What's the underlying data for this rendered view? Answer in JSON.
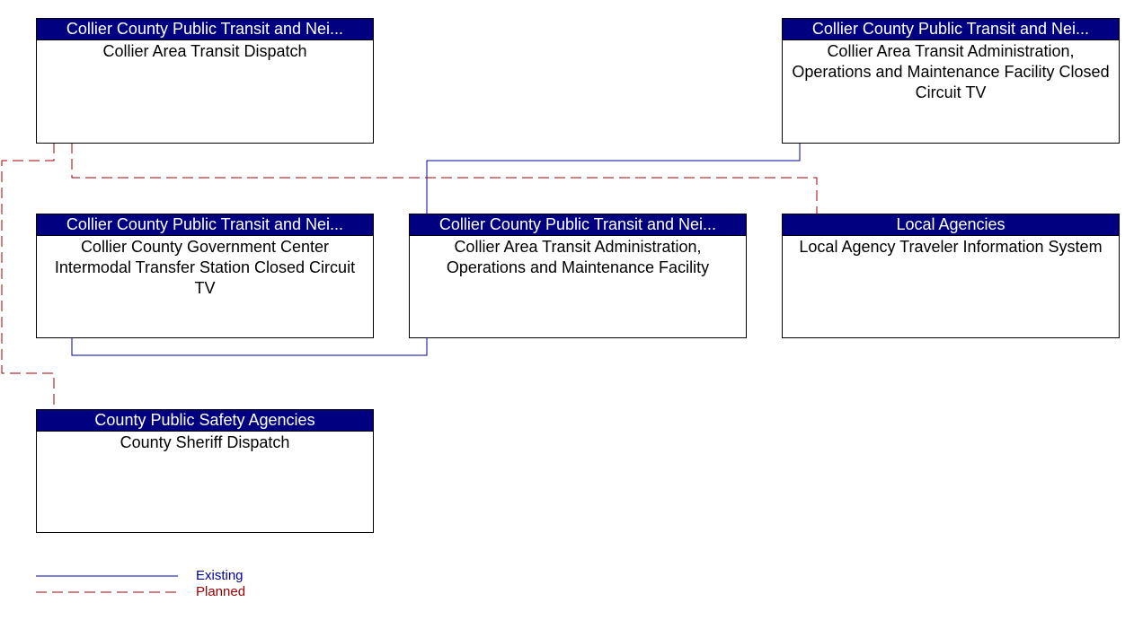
{
  "nodes": [
    {
      "id": "dispatch",
      "header": "Collier County Public Transit and Nei...",
      "body": "Collier Area Transit Dispatch"
    },
    {
      "id": "admin_cctv",
      "header": "Collier County Public Transit and Nei...",
      "body": "Collier Area Transit Administration, Operations and Maintenance Facility Closed Circuit TV"
    },
    {
      "id": "govctr_cctv",
      "header": "Collier County Public Transit and Nei...",
      "body": "Collier County Government Center Intermodal Transfer Station Closed Circuit TV"
    },
    {
      "id": "admin_facility",
      "header": "Collier County Public Transit and Nei...",
      "body": "Collier Area Transit Administration, Operations and Maintenance Facility"
    },
    {
      "id": "local_tis",
      "header": "Local Agencies",
      "body": "Local Agency Traveler Information System"
    },
    {
      "id": "sheriff",
      "header": "County Public Safety Agencies",
      "body": "County Sheriff Dispatch"
    }
  ],
  "connections": [
    {
      "from": "admin_cctv",
      "to": "admin_facility",
      "status": "existing"
    },
    {
      "from": "govctr_cctv",
      "to": "admin_facility",
      "status": "existing"
    },
    {
      "from": "dispatch",
      "to": "local_tis",
      "status": "planned"
    },
    {
      "from": "dispatch",
      "to": "sheriff",
      "status": "planned"
    }
  ],
  "legend": {
    "existing": {
      "label": "Existing",
      "color": "#0000a0"
    },
    "planned": {
      "label": "Planned",
      "color": "#a00000"
    }
  }
}
